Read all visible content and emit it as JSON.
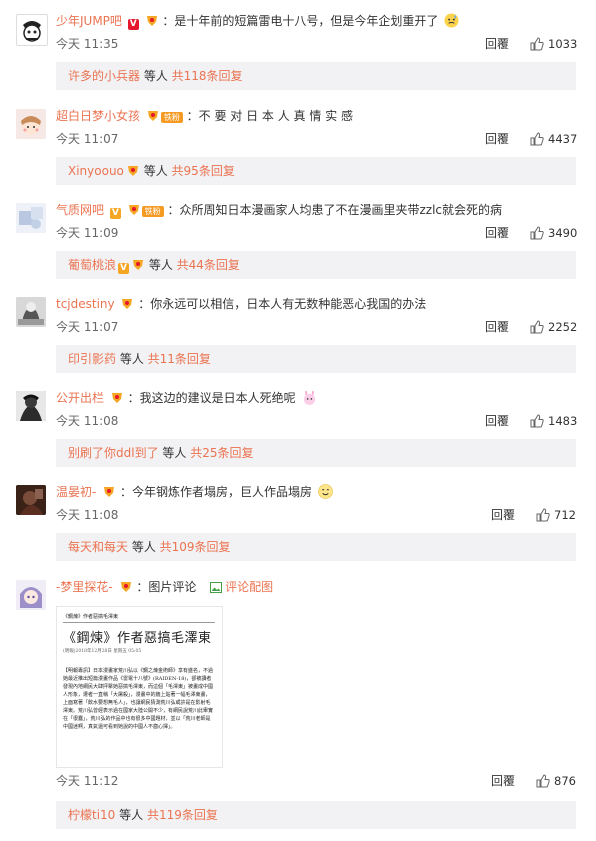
{
  "comments": [
    {
      "user": "少年JUMP吧",
      "text": "：是十年前的短篇雷电十八号，但是今年企划重开了",
      "time": "今天 11:35",
      "reply_label": "回覆",
      "likes": "1033",
      "sub": {
        "names": "许多的小兵器",
        "mid": " 等人 ",
        "count": "共118条回复"
      }
    },
    {
      "user": "超白日梦小女孩",
      "fan_badge": "铁粉",
      "text": "：不 要 对 日 本 人 真 情 实 感",
      "time": "今天 11:07",
      "reply_label": "回覆",
      "likes": "4437",
      "sub": {
        "names": "Xinyoouo",
        "mid": " 等人 ",
        "count": "共95条回复"
      }
    },
    {
      "user": "气质网吧",
      "fan_badge": "铁粉",
      "text": "：众所周知日本漫画家人均患了不在漫画里夹带zzlc就会死的病",
      "time": "今天 11:09",
      "reply_label": "回覆",
      "likes": "3490",
      "sub": {
        "names": "葡萄桃浪",
        "mid": " 等人 ",
        "count": "共44条回复"
      }
    },
    {
      "user": "tcjdestiny",
      "text": "：你永远可以相信，日本人有无数种能恶心我国的办法",
      "time": "今天 11:07",
      "reply_label": "回覆",
      "likes": "2252",
      "sub": {
        "names": "印引影药",
        "mid": " 等人 ",
        "count": "共11条回复"
      }
    },
    {
      "user": "公开出栏",
      "text": "：我这边的建议是日本人死绝呢",
      "time": "今天 11:08",
      "reply_label": "回覆",
      "likes": "1483",
      "sub": {
        "names": "别刷了你ddl到了",
        "mid": " 等人 ",
        "count": "共25条回复"
      }
    },
    {
      "user": "温晏初-",
      "text": "：今年钢炼作者塌房，巨人作品塌房",
      "time": "今天 11:08",
      "reply_label": "回覆",
      "likes": "712",
      "sub": {
        "names": "每天和每天",
        "mid": " 等人 ",
        "count": "共109条回复"
      }
    },
    {
      "user": "-梦里探花-",
      "text": "：图片评论",
      "pic_link": "评论配图",
      "time": "今天 11:12",
      "reply_label": "回覆",
      "likes": "876",
      "sub": {
        "names": "柠檬ti10",
        "mid": " 等人 ",
        "count": "共119条回复"
      }
    }
  ],
  "image": {
    "header": "《鋼煉》作者惡搞毛澤東",
    "title": "《鋼煉》作者惡搞毛澤東",
    "byline": "(明報)2018年12月28日 星期五 05:05",
    "body": "【明報專訊】日本漫畫家荒川弘以《鋼之煉金術師》享有盛名，不過她最近推出短篇漫畫作品《雷電十八號》(RAIDEN-18)，卻被讀者發現內地網民大肆抨擊她惡搞毛澤東，而這個「毛澤東」被畫成中國人形象，遭者一直稱「大屠殺」，漫畫中的牆上貼著一幅毛澤東畫，上面寫著「飲水要想無毛人」，也讓網民猜測荒川弘或許是在影射毛澤東。荒川弘曾經表示過在國家大陸公開不少，有網民說荒川此舉實在「很蠢」，荒川弘的作品中也有很多中國題材，並以「荒川老師是中國迷啊，真氣還可看到她說的中國人不齒心揮」。"
  },
  "colors": {
    "accent": "#eb7350",
    "sub_bg": "#f2f2f5"
  }
}
